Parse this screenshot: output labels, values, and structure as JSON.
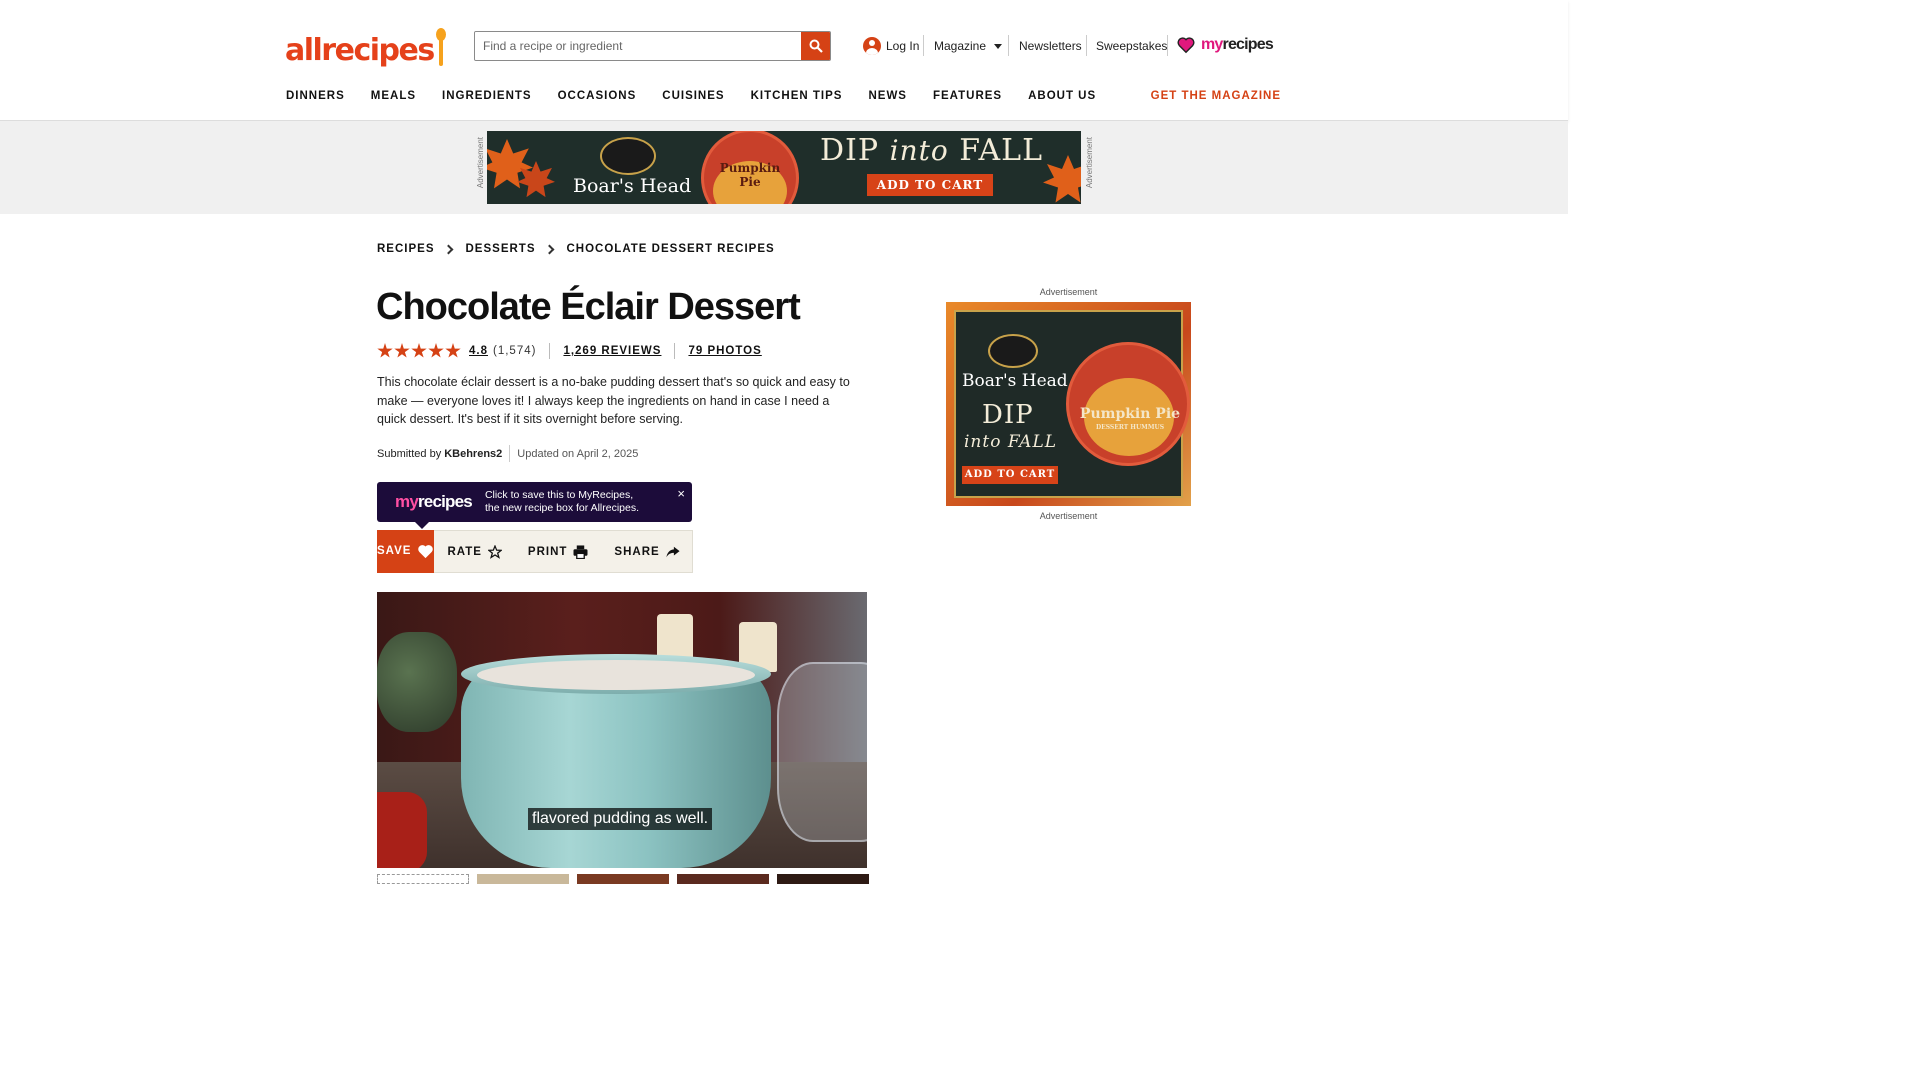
{
  "header": {
    "logo_text": "allrecipes",
    "search_placeholder": "Find a recipe or ingredient",
    "login": "Log In",
    "magazine": "Magazine",
    "newsletters": "Newsletters",
    "sweepstakes": "Sweepstakes",
    "myrecipes_my": "my",
    "myrecipes_recipes": "recipes",
    "nav": [
      "DINNERS",
      "MEALS",
      "INGREDIENTS",
      "OCCASIONS",
      "CUISINES",
      "KITCHEN TIPS",
      "NEWS",
      "FEATURES",
      "ABOUT US"
    ],
    "get_magazine": "GET THE MAGAZINE"
  },
  "banner_ad": {
    "label": "Advertisement",
    "brand": "Boar's Head",
    "product": "Pumpkin Pie",
    "headline_dip": "DIP",
    "headline_into": "into",
    "headline_fall": "FALL",
    "cta": "ADD TO CART"
  },
  "breadcrumb": [
    "RECIPES",
    "DESSERTS",
    "CHOCOLATE DESSERT RECIPES"
  ],
  "recipe": {
    "title": "Chocolate Éclair Dessert",
    "rating_value": "4.8",
    "rating_count": "(1,574)",
    "reviews": "1,269 REVIEWS",
    "photos": "79 PHOTOS",
    "description": "This chocolate éclair dessert is a no-bake pudding dessert that's so quick and easy to make — everyone loves it! I always keep the ingredients on hand in case I need a quick dessert. It's best if it sits overnight before serving.",
    "submitted_by_label": "Submitted by",
    "author": "KBehrens2",
    "updated": "Updated on April 2, 2025"
  },
  "myrecipes_tip": {
    "logo_my": "my",
    "logo_recipes": "recipes",
    "line1": "Click to save this to MyRecipes,",
    "line2": "the new recipe box for Allrecipes.",
    "close": "×"
  },
  "actions": {
    "save": "SAVE",
    "rate": "RATE",
    "print": "PRINT",
    "share": "SHARE"
  },
  "video": {
    "caption": "flavored pudding as well."
  },
  "side_ad": {
    "label_top": "Advertisement",
    "label_bottom": "Advertisement",
    "brand": "Boar's Head",
    "dip": "DIP",
    "into_fall": "into FALL",
    "product": "Pumpkin Pie",
    "product_sub": "DESSERT HUMMUS",
    "cta": "ADD TO CART"
  },
  "colors": {
    "brand_orange": "#d54215",
    "myrecipes_purple": "#1c0c3a",
    "myrecipes_pink": "#e0187d",
    "action_bg": "#f4f1e9"
  }
}
